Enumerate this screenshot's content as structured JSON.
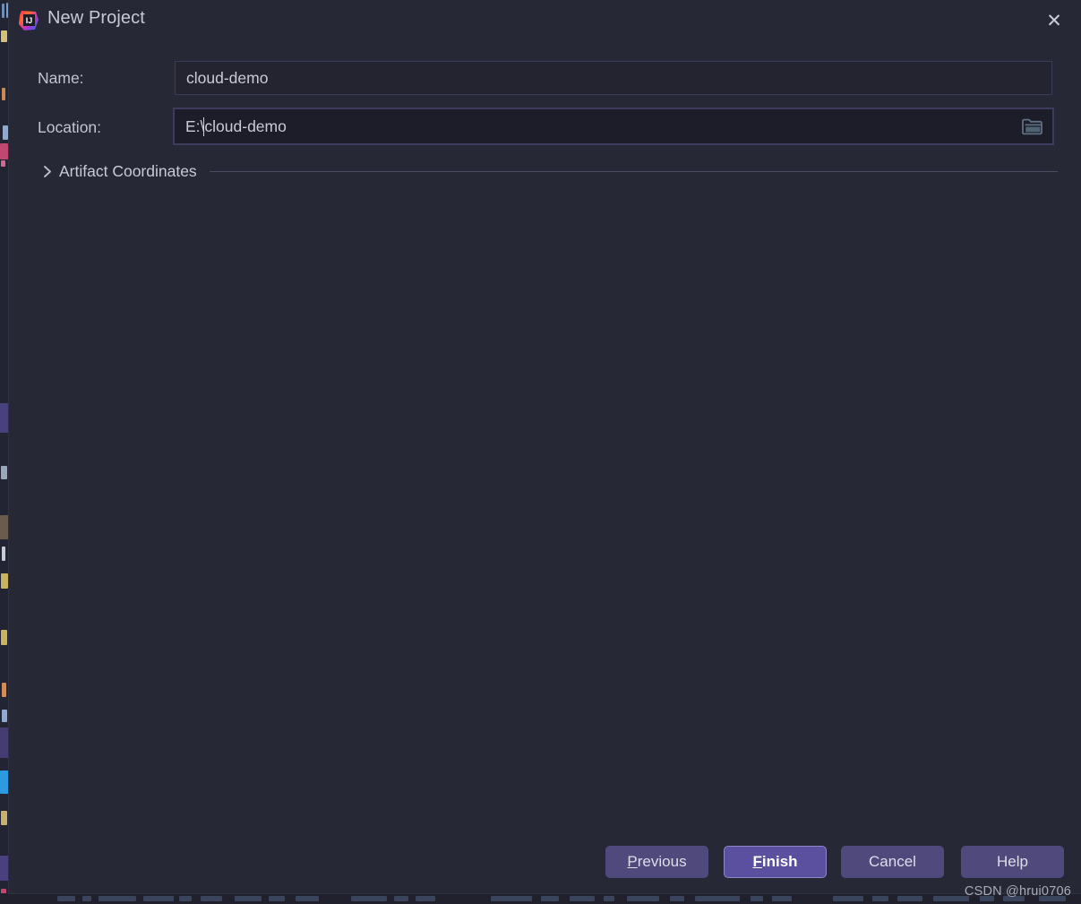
{
  "window": {
    "title": "New Project",
    "app_icon": "intellij-idea-logo",
    "close_icon": "✕",
    "background_color": "#272836"
  },
  "form": {
    "name": {
      "label": "Name:",
      "value": "cloud-demo",
      "placeholder": "",
      "focused": false
    },
    "location": {
      "label": "Location:",
      "value_before_caret": "E:\\",
      "value_after_caret": "cloud-demo",
      "full_value": "E:\\cloud-demo",
      "placeholder": "",
      "focused": true,
      "browse_icon": "folder-icon"
    }
  },
  "sections": [
    {
      "label": "Artifact Coordinates",
      "expanded": false,
      "chevron_icon": "chevron-right-icon"
    }
  ],
  "buttons": [
    {
      "id": "previous",
      "label": "Previous",
      "mnemonic": "P",
      "default": false
    },
    {
      "id": "finish",
      "label": "Finish",
      "mnemonic": "F",
      "default": true
    },
    {
      "id": "cancel",
      "label": "Cancel",
      "mnemonic": "",
      "default": false
    },
    {
      "id": "help",
      "label": "Help",
      "mnemonic": "",
      "default": false
    }
  ],
  "button_labels": {
    "previous_head": "P",
    "previous_tail": "revious",
    "finish_head": "F",
    "finish_tail": "inish",
    "cancel": "Cancel",
    "help": "Help"
  },
  "watermark": {
    "text": "CSDN @hrui0706"
  },
  "theme": {
    "accent": "#5b4fa0",
    "button": "#504a7c",
    "dialog_bg": "#272836",
    "field_bg": "#23242f",
    "field_focus_bg": "#1c1d28",
    "text": "#c7c9d6",
    "separator": "#4a4d61"
  }
}
